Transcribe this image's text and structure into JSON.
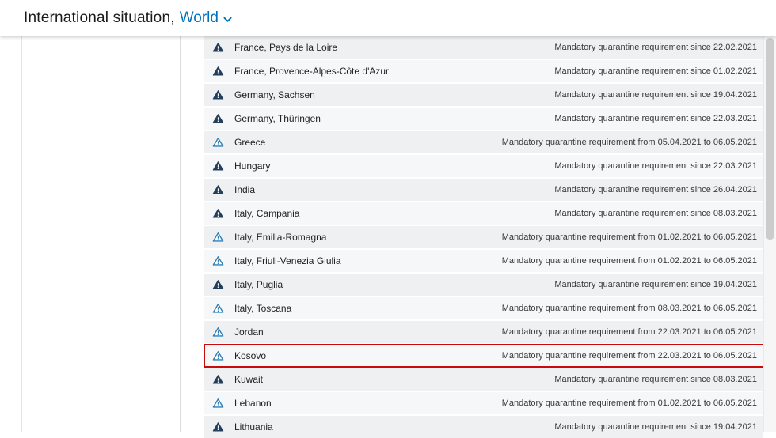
{
  "header": {
    "title_prefix": "International situation,",
    "region": "World"
  },
  "list": {
    "highlighted_country": "Kosovo",
    "rows": [
      {
        "country": "France, Pays de la Loire",
        "status": "Mandatory quarantine requirement since 22.02.2021",
        "severity": "dark"
      },
      {
        "country": "France, Provence-Alpes-Côte d'Azur",
        "status": "Mandatory quarantine requirement since 01.02.2021",
        "severity": "dark"
      },
      {
        "country": "Germany, Sachsen",
        "status": "Mandatory quarantine requirement since 19.04.2021",
        "severity": "dark"
      },
      {
        "country": "Germany, Thüringen",
        "status": "Mandatory quarantine requirement since 22.03.2021",
        "severity": "dark"
      },
      {
        "country": "Greece",
        "status": "Mandatory quarantine requirement from 05.04.2021 to 06.05.2021",
        "severity": "blue"
      },
      {
        "country": "Hungary",
        "status": "Mandatory quarantine requirement since 22.03.2021",
        "severity": "dark"
      },
      {
        "country": "India",
        "status": "Mandatory quarantine requirement since 26.04.2021",
        "severity": "dark"
      },
      {
        "country": "Italy, Campania",
        "status": "Mandatory quarantine requirement since 08.03.2021",
        "severity": "dark"
      },
      {
        "country": "Italy, Emilia-Romagna",
        "status": "Mandatory quarantine requirement from 01.02.2021 to 06.05.2021",
        "severity": "blue"
      },
      {
        "country": "Italy, Friuli-Venezia Giulia",
        "status": "Mandatory quarantine requirement from 01.02.2021 to 06.05.2021",
        "severity": "blue"
      },
      {
        "country": "Italy, Puglia",
        "status": "Mandatory quarantine requirement since 19.04.2021",
        "severity": "dark"
      },
      {
        "country": "Italy, Toscana",
        "status": "Mandatory quarantine requirement from 08.03.2021 to 06.05.2021",
        "severity": "blue"
      },
      {
        "country": "Jordan",
        "status": "Mandatory quarantine requirement from 22.03.2021 to 06.05.2021",
        "severity": "blue"
      },
      {
        "country": "Kosovo",
        "status": "Mandatory quarantine requirement from 22.03.2021 to 06.05.2021",
        "severity": "blue"
      },
      {
        "country": "Kuwait",
        "status": "Mandatory quarantine requirement since 08.03.2021",
        "severity": "dark"
      },
      {
        "country": "Lebanon",
        "status": "Mandatory quarantine requirement from 01.02.2021 to 06.05.2021",
        "severity": "blue"
      },
      {
        "country": "Lithuania",
        "status": "Mandatory quarantine requirement since 19.04.2021",
        "severity": "dark"
      }
    ]
  },
  "colors": {
    "accent_blue": "#0072bc",
    "warning_dark": "#243f5c",
    "warning_blue": "#2f7fb6",
    "highlight_red": "#cb0b0b",
    "row_even": "#eef0f2",
    "row_odd": "#f5f7f8"
  }
}
